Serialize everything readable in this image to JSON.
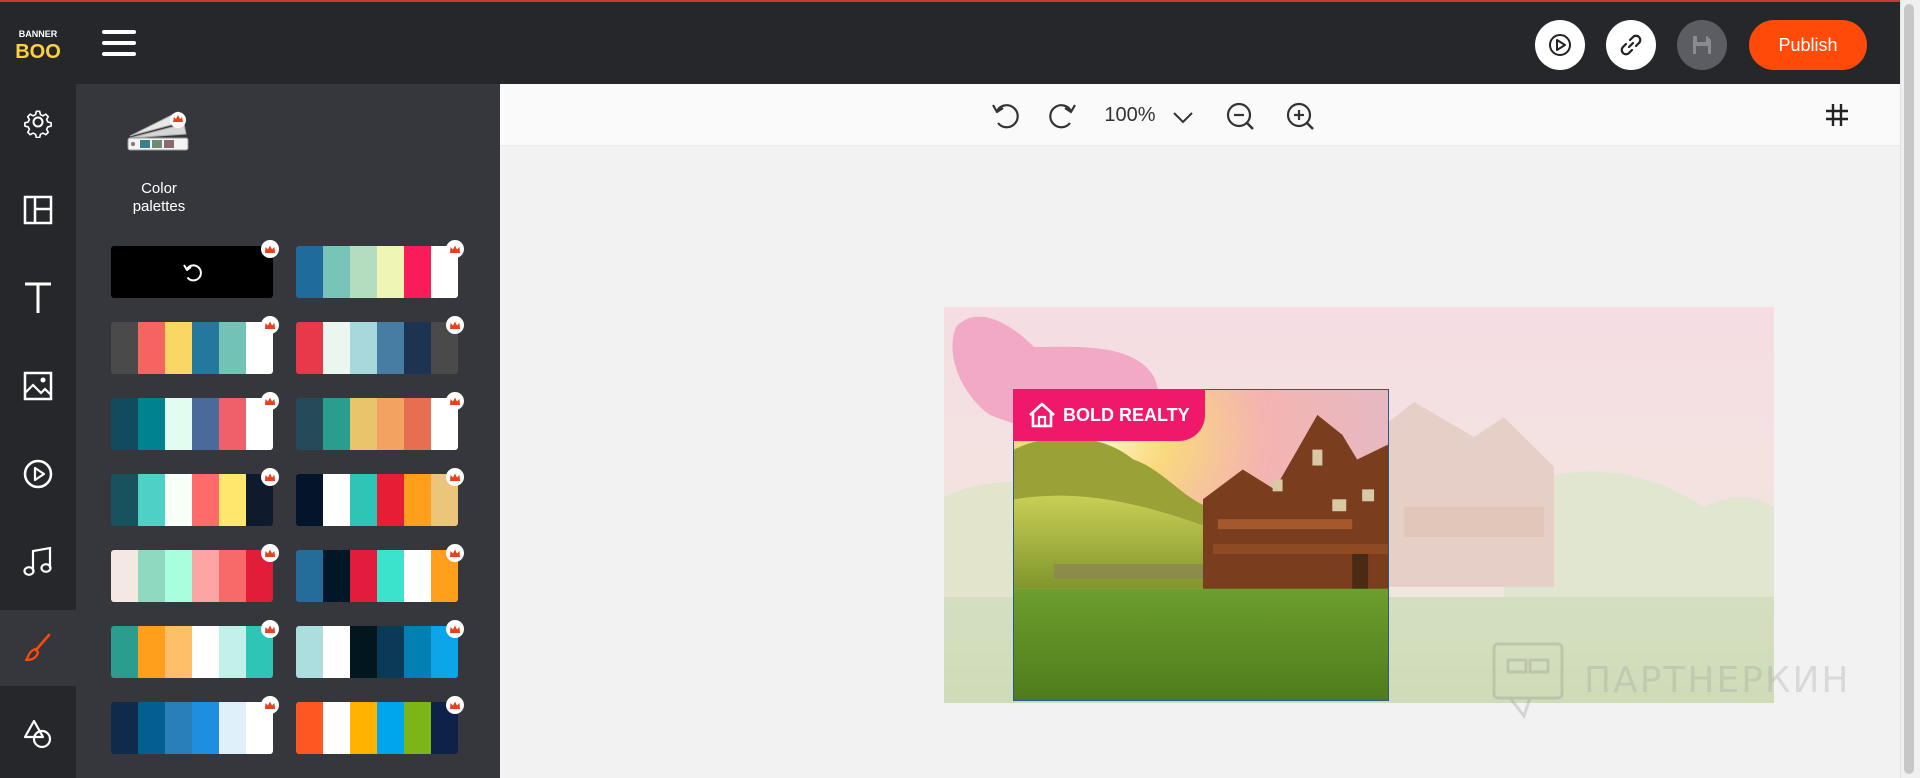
{
  "app": {
    "logo_text_top": "BANNER",
    "logo_text_bottom": "BOO"
  },
  "header": {
    "publish_label": "Publish"
  },
  "sidebar": {
    "items": [
      {
        "name": "gear-icon"
      },
      {
        "name": "layout-icon"
      },
      {
        "name": "text-icon"
      },
      {
        "name": "image-icon"
      },
      {
        "name": "play-icon"
      },
      {
        "name": "music-icon"
      },
      {
        "name": "brush-icon",
        "active": true
      },
      {
        "name": "shapes-icon"
      }
    ]
  },
  "panel": {
    "title_line1": "Color",
    "title_line2": "palettes",
    "palettes": [
      {
        "reset": true,
        "colors": [
          "#000000"
        ]
      },
      {
        "colors": [
          "#1f6c9c",
          "#78c4b8",
          "#b4dcbe",
          "#eef5b5",
          "#fa1b5b",
          "#ffffff"
        ]
      },
      {
        "colors": [
          "#4a4a4a",
          "#f46461",
          "#fad664",
          "#24779d",
          "#72c2b5",
          "#ffffff"
        ]
      },
      {
        "colors": [
          "#e8394a",
          "#eaf7f0",
          "#a7d8db",
          "#477da3",
          "#1c3451",
          "#4a4a4a"
        ]
      },
      {
        "colors": [
          "#124a60",
          "#00838f",
          "#e2fcef",
          "#4a6a9c",
          "#f0606a",
          "#ffffff"
        ]
      },
      {
        "colors": [
          "#254a5a",
          "#2a9d8f",
          "#e9c46a",
          "#f4a261",
          "#e76f51",
          "#ffffff"
        ]
      },
      {
        "colors": [
          "#17525e",
          "#4ed0c4",
          "#f7fff7",
          "#ff6b6b",
          "#ffe66d",
          "#0f1b2d"
        ]
      },
      {
        "colors": [
          "#02152b",
          "#ffffff",
          "#2ec4b6",
          "#e71d36",
          "#ff9f1c",
          "#eac57a"
        ]
      },
      {
        "colors": [
          "#f3e8e2",
          "#8fd9c1",
          "#a8ffdd",
          "#fda4a4",
          "#f86a6a",
          "#e11d3a"
        ]
      },
      {
        "colors": [
          "#246c9a",
          "#011627",
          "#e31c3d",
          "#3be3cc",
          "#ffffff",
          "#ff9f1c"
        ]
      },
      {
        "colors": [
          "#2a9d8f",
          "#ff9f1c",
          "#ffbf69",
          "#ffffff",
          "#c2f1ea",
          "#2ec4b6"
        ]
      },
      {
        "colors": [
          "#acdee0",
          "#ffffff",
          "#01161e",
          "#0a3a58",
          "#0280b3",
          "#0ba5e8"
        ]
      },
      {
        "colors": [
          "#102a4c",
          "#035f92",
          "#2980b9",
          "#1e8fe0",
          "#e0f0f8",
          "#ffffff"
        ]
      },
      {
        "colors": [
          "#ff5722",
          "#ffffff",
          "#ffb300",
          "#00a6ed",
          "#7cb518",
          "#0d2149"
        ]
      }
    ]
  },
  "toolbar": {
    "zoom_value": "100%"
  },
  "banner": {
    "brand_name": "BOLD REALTY"
  },
  "watermark": {
    "text": "ПАРТНЕРКИН"
  },
  "colors": {
    "accent": "#ff4a0a",
    "brand_pink": "#f0186a",
    "sidebar_bg": "#26272b",
    "panel_bg": "#36373c"
  }
}
